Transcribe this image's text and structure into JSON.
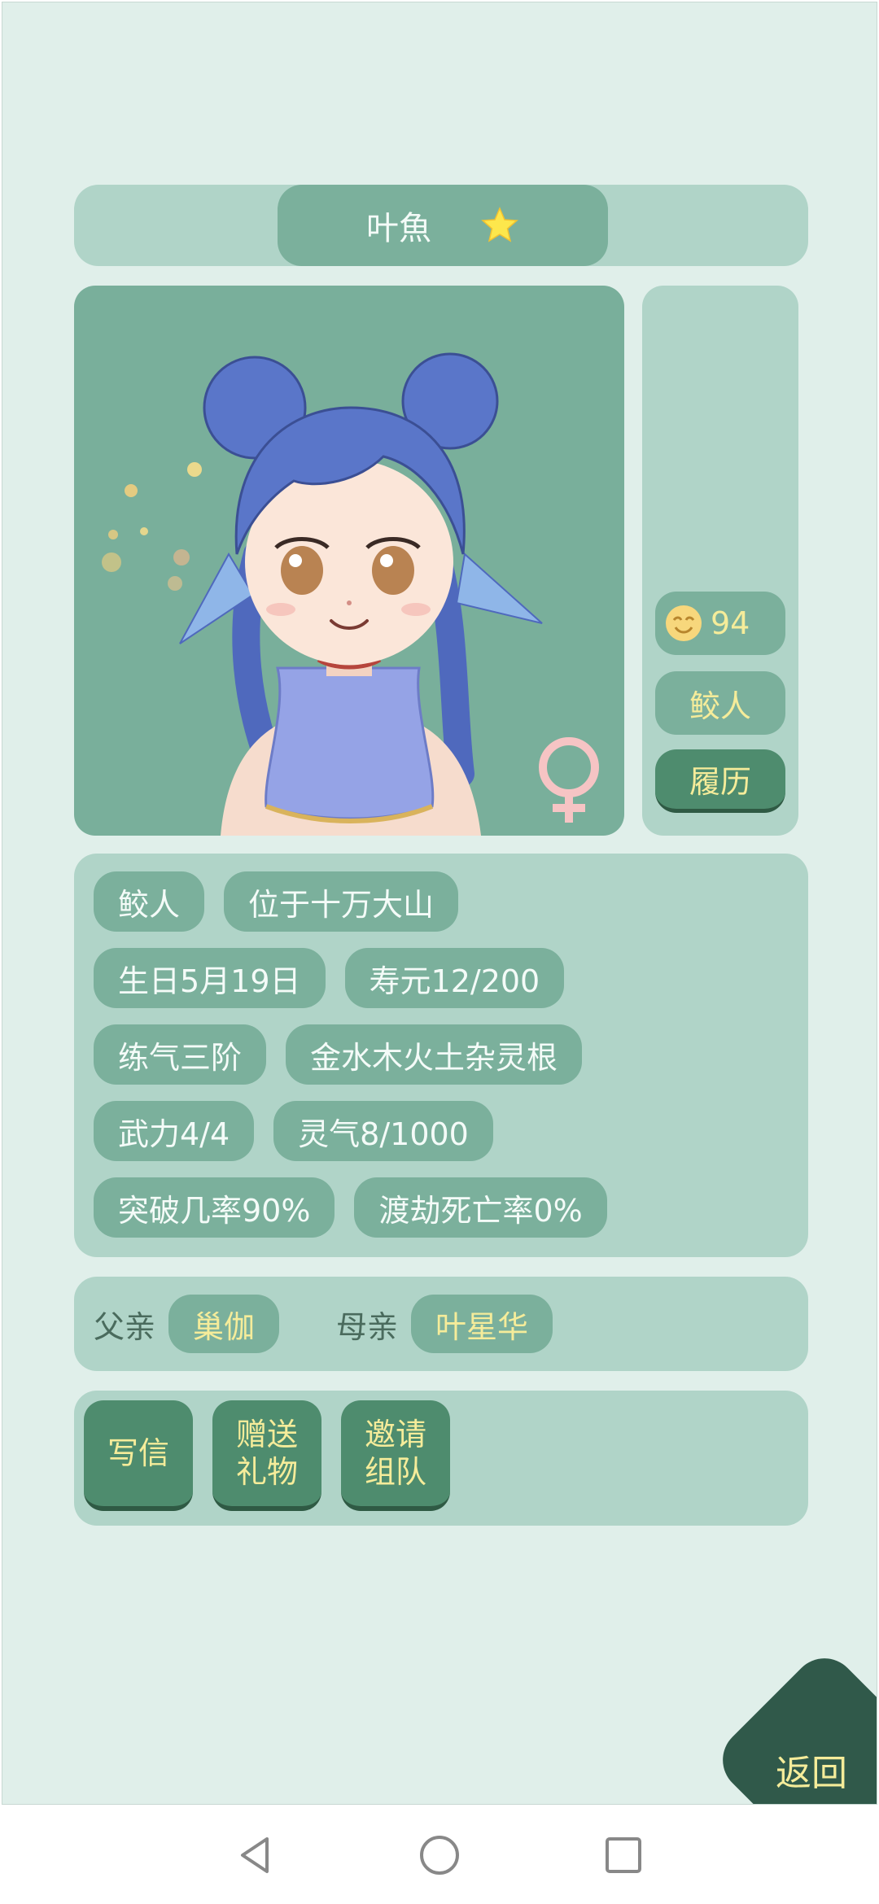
{
  "header": {
    "name": "叶魚"
  },
  "side": {
    "mood_value": "94",
    "race": "鲛人",
    "resume_label": "履历"
  },
  "info_rows": [
    [
      "鲛人",
      "位于十万大山"
    ],
    [
      "生日5月19日",
      "寿元12/200"
    ],
    [
      "练气三阶",
      "金水木火土杂灵根"
    ],
    [
      "武力4/4",
      "灵气8/1000"
    ],
    [
      "突破几率90%",
      "渡劫死亡率0%"
    ]
  ],
  "parents": {
    "father_label": "父亲",
    "father_name": "巢伽",
    "mother_label": "母亲",
    "mother_name": "叶星华"
  },
  "actions": {
    "write_letter": "写信",
    "send_gift": "赠送\n礼物",
    "invite_team": "邀请\n组队"
  },
  "back_label": "返回",
  "colors": {
    "background": "#e0efea",
    "panel": "#b0d4c8",
    "chip": "#7bb09c",
    "button": "#4e8c6e",
    "gold_text": "#f5ec9a",
    "back_button": "#30594a"
  },
  "icons": {
    "favorite": "star-icon",
    "gender": "female-symbol-icon",
    "mood": "smile-face-icon"
  }
}
